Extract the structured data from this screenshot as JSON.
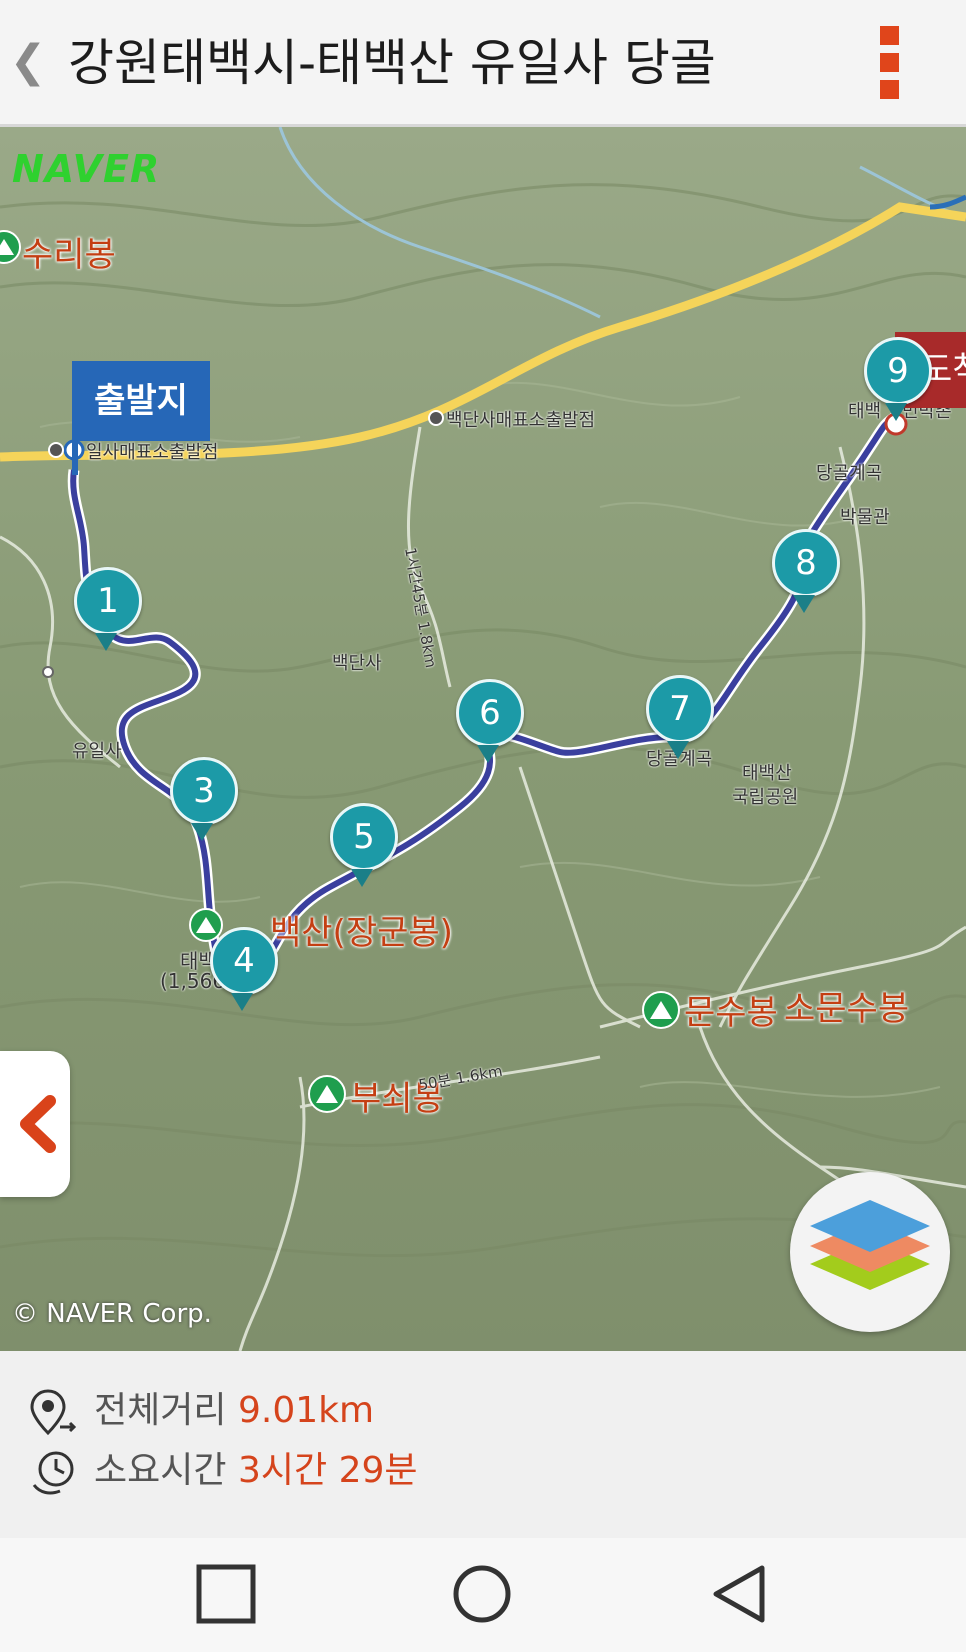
{
  "header": {
    "back_icon": "chevron-left-icon",
    "title": "강원태백시-태백산 유일사 당골",
    "menu_icon": "more-vertical-icon",
    "accent_color": "#e0451b"
  },
  "map": {
    "provider_logo": "NAVER",
    "copyright": "© NAVER Corp.",
    "start_label": "출발지",
    "end_label": "도착",
    "route_color": "#3a3f9e",
    "marker_color": "#1c9aa7",
    "waypoints": [
      "1",
      "3",
      "4",
      "5",
      "6",
      "7",
      "8",
      "9"
    ],
    "peaks": {
      "suribong": "수리봉",
      "taebaeksan": "백산(장군봉)",
      "munsubong": "문수봉",
      "somunsubong": "소문수봉",
      "busoebong": "부쇠봉"
    },
    "places": {
      "yuilsa_ticket": "일사매표소출발점",
      "baekdansa_ticket": "백단사매표소출발점",
      "baekdansa": "백단사",
      "yuilsa": "유일사",
      "danggol_valley": "당골계곡",
      "national_park_line1": "태백산",
      "national_park_line2": "국립공원",
      "minbak": "태백",
      "minbak_right": "민박촌",
      "danggol_top": "당골계곡",
      "museum": "박물관",
      "peak_elev_name": "태백",
      "peak_elev": "(1,566"
    },
    "trail_labels": {
      "baekdansa_trail": "1시간45분 1.8km",
      "busoe_trail": "50분 1.6km"
    },
    "layers_icon": "layers-icon",
    "collapse_icon": "chevron-left-icon"
  },
  "info": {
    "distance_label": "전체거리",
    "distance_value": "9.01km",
    "distance_icon": "location-pin-icon",
    "time_label": "소요시간",
    "time_value": "3시간 29분",
    "time_icon": "clock-icon"
  },
  "navbar": {
    "recents_icon": "square-icon",
    "home_icon": "circle-icon",
    "back_icon": "triangle-back-icon"
  }
}
